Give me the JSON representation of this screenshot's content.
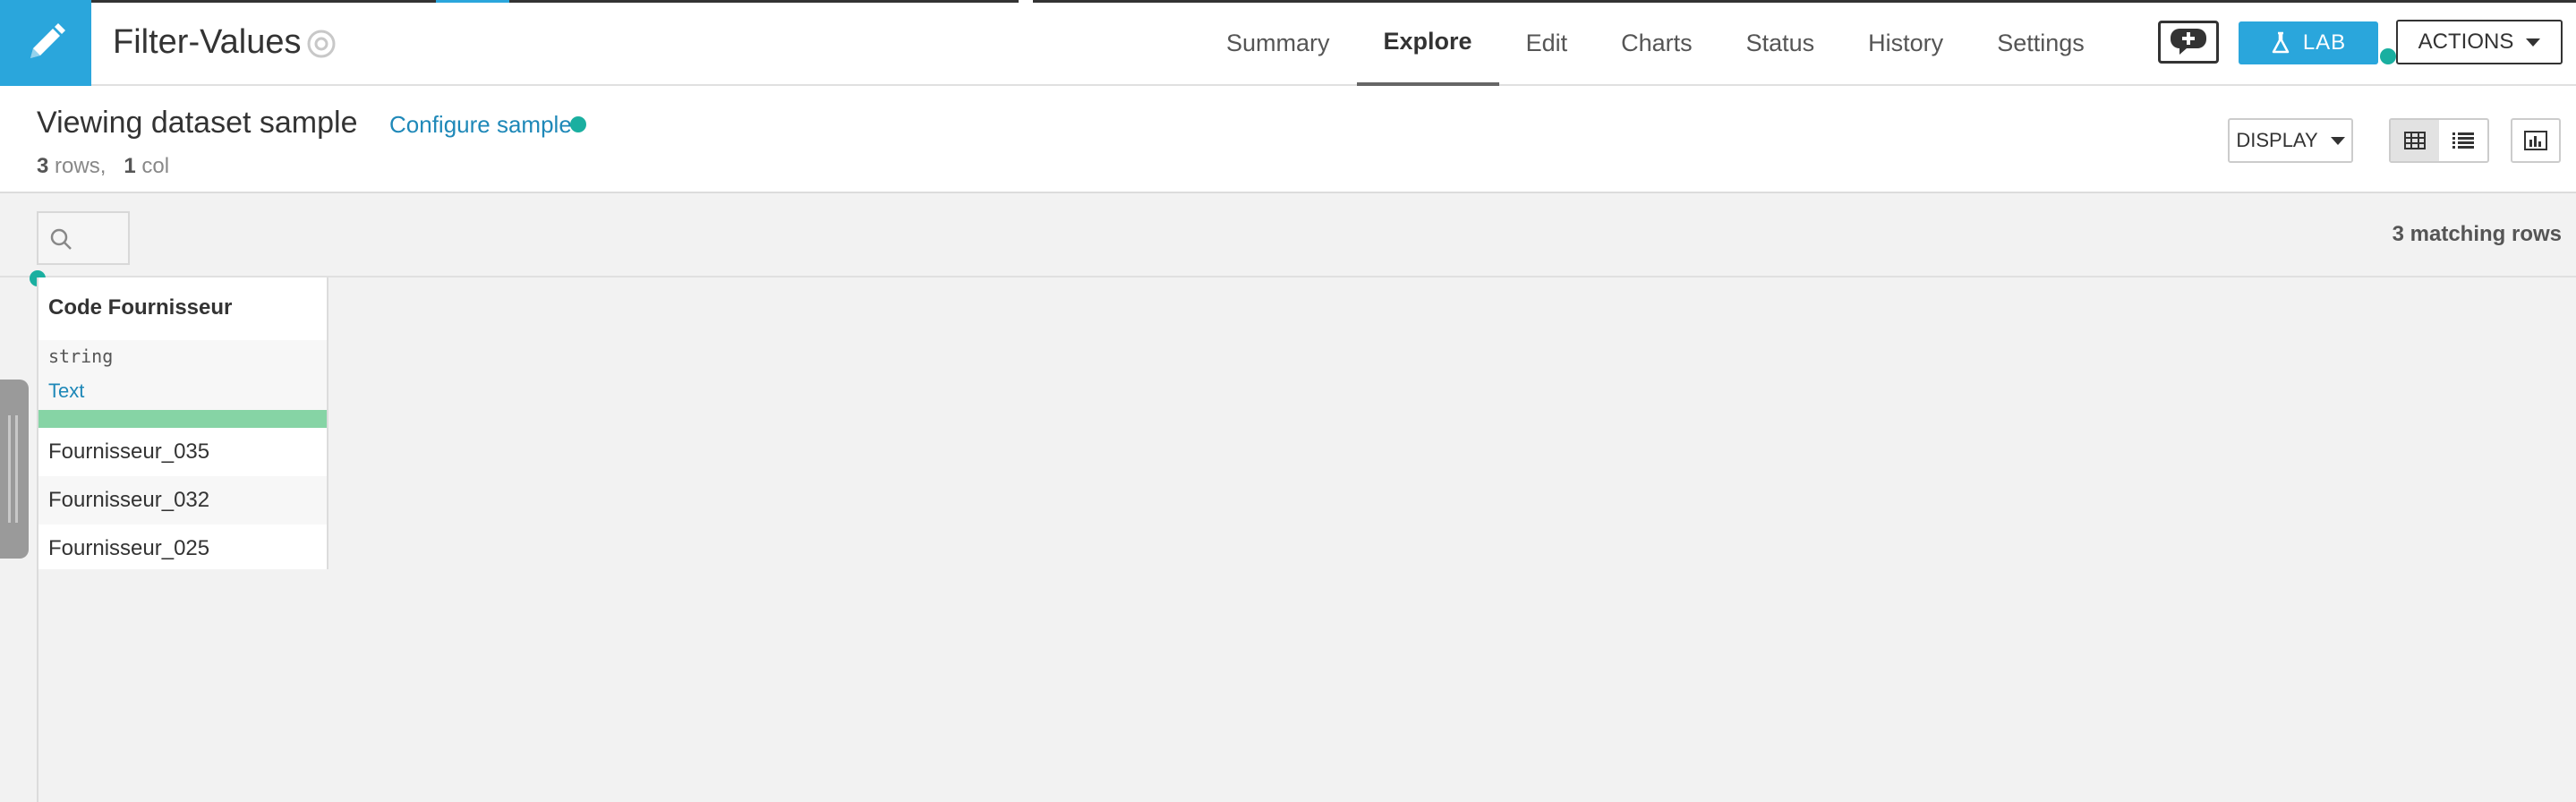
{
  "header": {
    "dataset_name": "Filter-Values",
    "tabs": [
      "Summary",
      "Explore",
      "Edit",
      "Charts",
      "Status",
      "History",
      "Settings"
    ],
    "active_tab": "Explore",
    "lab_label": "LAB",
    "actions_label": "ACTIONS"
  },
  "subheader": {
    "title": "Viewing dataset sample",
    "configure_link": "Configure sample",
    "rows_count": "3",
    "rows_label": "rows,",
    "cols_count": "1",
    "cols_label": "col",
    "display_label": "DISPLAY"
  },
  "filter": {
    "matching_rows": "3 matching rows"
  },
  "table": {
    "column": {
      "name": "Code Fournisseur",
      "storage_type": "string",
      "meaning": "Text",
      "validity_pct": 100
    },
    "rows": [
      "Fournisseur_035",
      "Fournisseur_032",
      "Fournisseur_025"
    ]
  },
  "colors": {
    "accent": "#2aa6dc",
    "link": "#1e88b8",
    "valid_bar": "#86d4a5",
    "hint_dot": "#1aafa0"
  },
  "icons": {
    "brand": "pencil-icon",
    "status": "compass-icon",
    "discuss": "chat-add-icon",
    "lab": "flask-icon",
    "search": "search-icon",
    "table_view": "grid-icon",
    "list_view": "list-icon",
    "charts": "bar-chart-icon"
  }
}
